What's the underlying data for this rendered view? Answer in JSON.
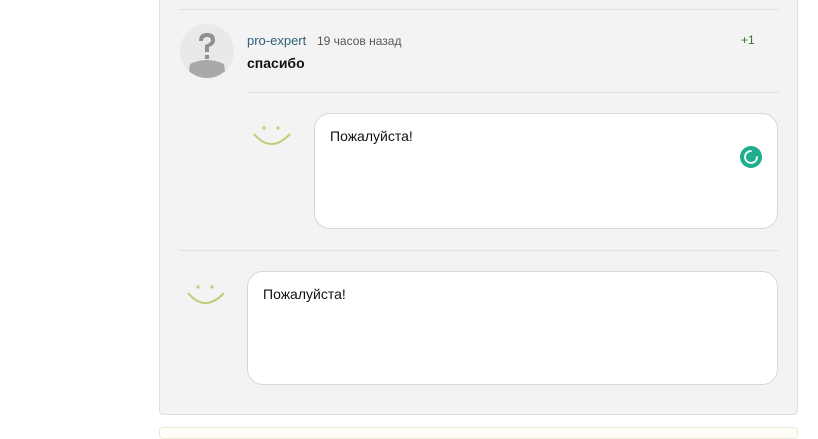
{
  "comment": {
    "author": "pro-expert",
    "time": "19 часов назад",
    "rating": "+1",
    "text": "спасибо"
  },
  "reply_nested": {
    "value": "Пожалуйста!"
  },
  "reply_main": {
    "value": "Пожалуйста!"
  },
  "icons": {
    "avatar": "question-mark-avatar-icon",
    "reply_avatar": "smile-icon",
    "status": "loading-spinner-icon"
  },
  "colors": {
    "panel": "#f3f3f3",
    "author_link": "#2f5f7c",
    "rating": "#3d6e2f",
    "smile": "#b9cf7a",
    "spinner": "#1fae8e"
  }
}
